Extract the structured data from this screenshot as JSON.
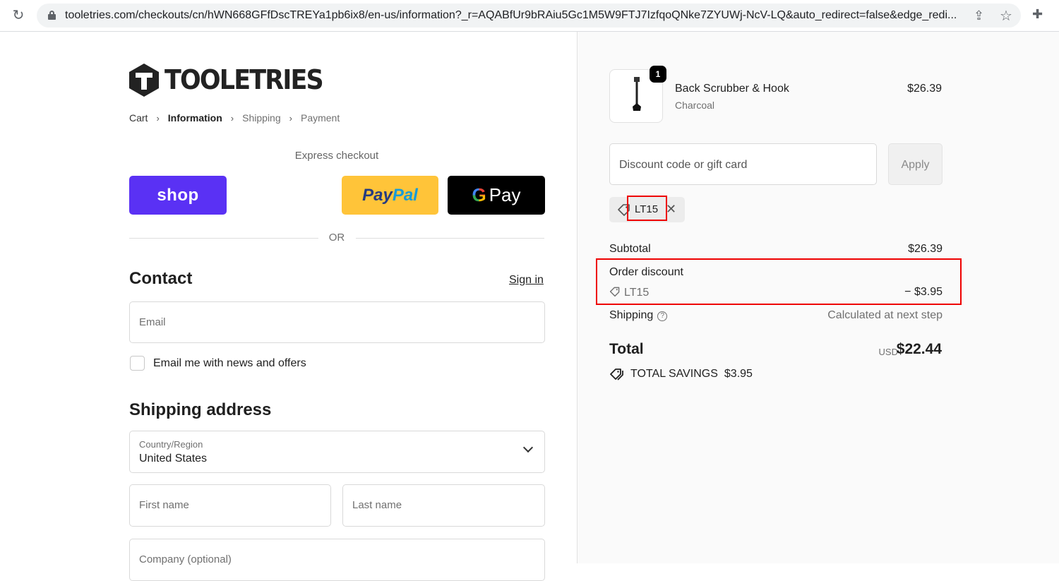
{
  "browser": {
    "url": "tooletries.com/checkouts/cn/hWN668GFfDscTREYa1pb6ix8/en-us/information?_r=AQABfUr9bRAiu5Gc1M5W9FTJ7IzfqoQNke7ZYUWj-NcV-LQ&auto_redirect=false&edge_redi..."
  },
  "brand": {
    "name": "TOOLETRIES"
  },
  "breadcrumb": {
    "cart": "Cart",
    "information": "Information",
    "shipping": "Shipping",
    "payment": "Payment"
  },
  "express": {
    "title": "Express checkout",
    "shop_label": "shop",
    "paypal_pay": "Pay",
    "paypal_pal": "Pal",
    "gpay_g": "G",
    "gpay_label": "Pay",
    "or": "OR"
  },
  "contact": {
    "heading": "Contact",
    "sign_in": "Sign in",
    "email_placeholder": "Email",
    "news_label": "Email me with news and offers"
  },
  "shipping_address": {
    "heading": "Shipping address",
    "country_label": "Country/Region",
    "country_value": "United States",
    "first_name_placeholder": "First name",
    "last_name_placeholder": "Last name",
    "company_placeholder": "Company (optional)"
  },
  "summary": {
    "product": {
      "name": "Back Scrubber & Hook",
      "variant": "Charcoal",
      "price": "$26.39",
      "quantity": "1"
    },
    "discount_placeholder": "Discount code or gift card",
    "apply": "Apply",
    "applied_code": "LT15",
    "subtotal_label": "Subtotal",
    "subtotal_value": "$26.39",
    "order_discount_label": "Order discount",
    "order_discount_code": "LT15",
    "order_discount_value": "− $3.95",
    "shipping_label": "Shipping",
    "shipping_value": "Calculated at next step",
    "total_label": "Total",
    "currency": "USD",
    "total_value": "$22.44",
    "savings_label": "TOTAL SAVINGS",
    "savings_value": "$3.95"
  },
  "colors": {
    "shop": "#5a31f4",
    "paypal": "#ffc439",
    "gpay": "#000000",
    "highlight": "#ee0000"
  },
  "icons": [
    "reload-icon",
    "lock-icon",
    "share-icon",
    "star-icon",
    "extensions-icon",
    "tag-icon",
    "close-icon",
    "help-icon",
    "chevron-down-icon"
  ]
}
